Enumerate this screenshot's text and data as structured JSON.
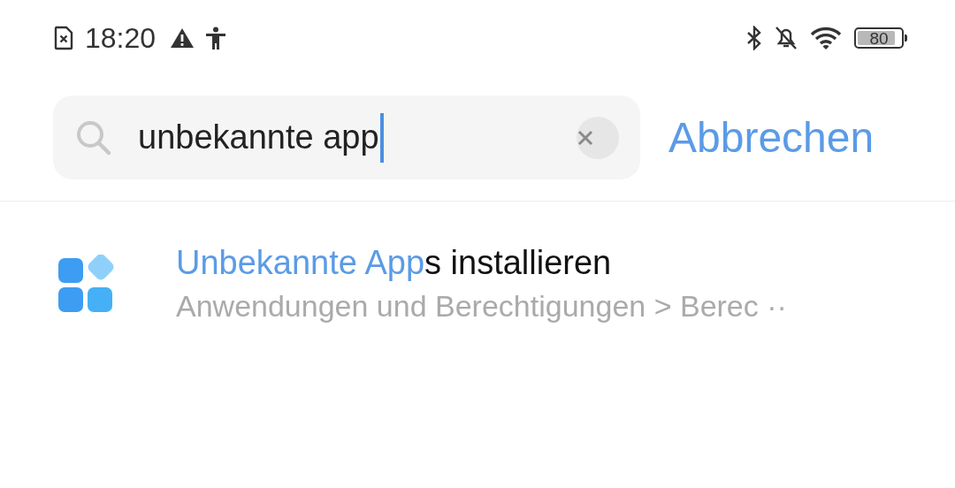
{
  "status_bar": {
    "time": "18:20",
    "battery": "80"
  },
  "search": {
    "value": "unbekannte app",
    "focused": true,
    "cancel": "Abbrechen"
  },
  "results": [
    {
      "title_parts": [
        {
          "text": "Unbekannte App",
          "matched": true
        },
        {
          "text": "s installieren",
          "matched": false
        }
      ],
      "path": "Anwendungen und Berechtigungen > Berec ··"
    }
  ]
}
